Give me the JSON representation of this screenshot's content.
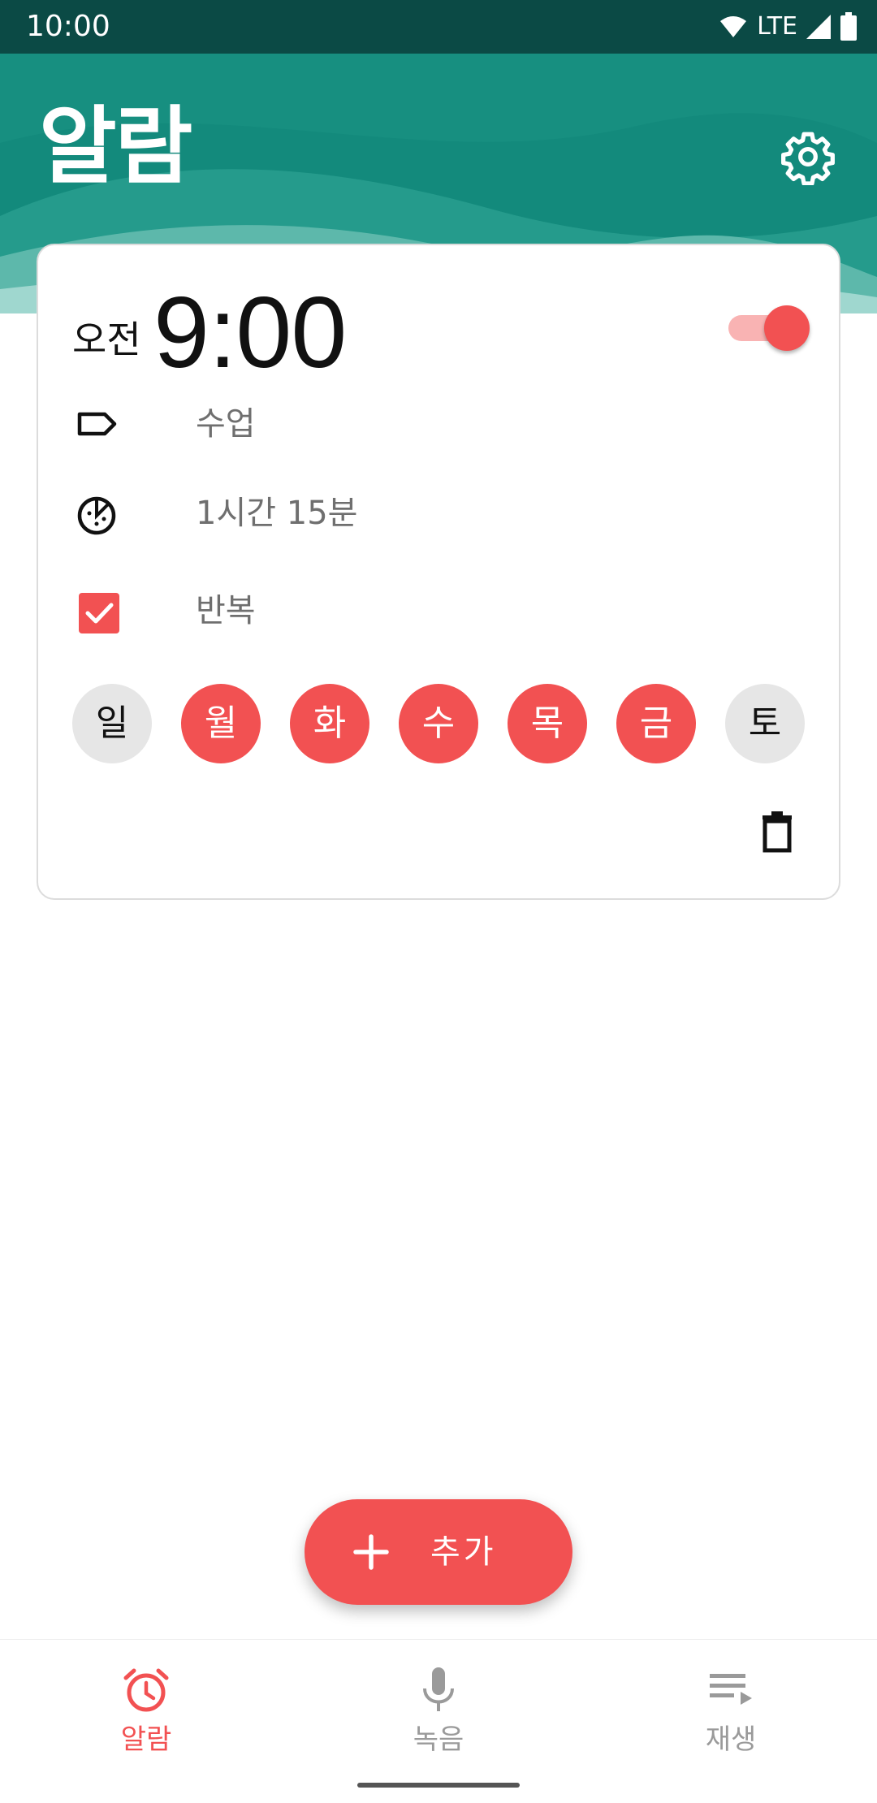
{
  "status_bar": {
    "time": "10:00",
    "network": "LTE",
    "icons": [
      "wifi-icon",
      "cell-signal-icon",
      "battery-icon"
    ]
  },
  "header": {
    "title": "알람",
    "settings_icon": "gear-icon"
  },
  "alarm": {
    "ampm": "오전",
    "time": "9:00",
    "enabled": true,
    "label": "수업",
    "label_icon": "label-tag-icon",
    "remaining": "1시간 15분",
    "remaining_icon": "timer-icon",
    "repeat_label": "반복",
    "repeat_checked": true,
    "days": [
      {
        "label": "일",
        "selected": false
      },
      {
        "label": "월",
        "selected": true
      },
      {
        "label": "화",
        "selected": true
      },
      {
        "label": "수",
        "selected": true
      },
      {
        "label": "목",
        "selected": true
      },
      {
        "label": "금",
        "selected": true
      },
      {
        "label": "토",
        "selected": false
      }
    ],
    "delete_icon": "trash-icon"
  },
  "fab": {
    "label": "추가",
    "icon": "plus-icon"
  },
  "bottom_nav": {
    "items": [
      {
        "label": "알람",
        "icon": "alarm-clock-icon",
        "active": true
      },
      {
        "label": "녹음",
        "icon": "microphone-icon",
        "active": false
      },
      {
        "label": "재생",
        "icon": "playlist-play-icon",
        "active": false
      }
    ]
  },
  "colors": {
    "accent": "#f25152",
    "header": "#138a7c",
    "status_bar": "#0b4a45",
    "inactive": "#9a9a9a"
  }
}
